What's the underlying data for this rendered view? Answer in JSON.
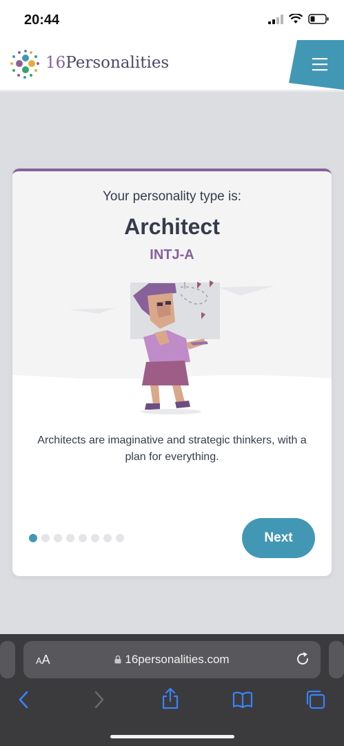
{
  "status_bar": {
    "time": "20:44"
  },
  "header": {
    "brand_number": "16",
    "brand_name": "Personalities",
    "menu_icon": "hamburger-menu-icon",
    "accent_color": "#4298b4"
  },
  "result_card": {
    "lead": "Your personality type is:",
    "type_name": "Architect",
    "type_code": "INTJ-A",
    "description": "Architects are imaginative and strategic thinkers, with a plan for everything.",
    "progress": {
      "current": 1,
      "total": 8
    },
    "next_label": "Next",
    "accent_color": "#88619a"
  },
  "browser": {
    "text_size_label": "AA",
    "url": "16personalities.com",
    "icons": [
      "back-icon",
      "forward-icon",
      "share-icon",
      "bookmarks-icon",
      "tabs-icon",
      "lock-icon",
      "reload-icon"
    ]
  }
}
